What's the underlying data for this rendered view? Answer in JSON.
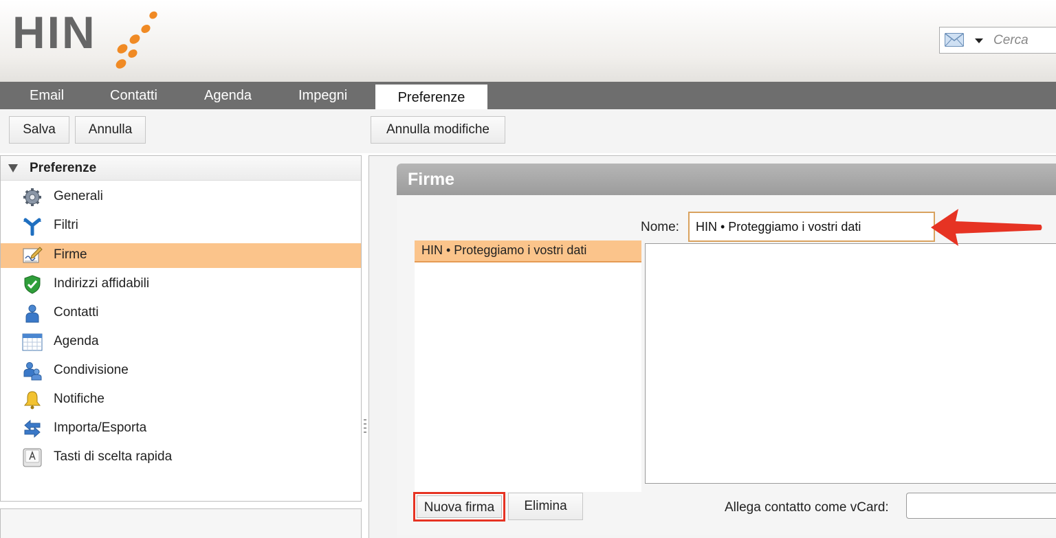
{
  "header": {
    "logo_text": "HIN",
    "search": {
      "placeholder": "Cerca",
      "icon": "envelope-icon"
    }
  },
  "nav": {
    "tabs": [
      {
        "label": "Email"
      },
      {
        "label": "Contatti"
      },
      {
        "label": "Agenda"
      },
      {
        "label": "Impegni"
      },
      {
        "label": "Preferenze",
        "active": true
      }
    ]
  },
  "toolbar": {
    "save_label": "Salva",
    "cancel_label": "Annulla",
    "undo_changes_label": "Annulla modifiche"
  },
  "sidebar": {
    "title": "Preferenze",
    "items": [
      {
        "label": "Generali",
        "icon": "gear-icon"
      },
      {
        "label": "Filtri",
        "icon": "filter-icon"
      },
      {
        "label": "Firme",
        "icon": "signature-icon",
        "selected": true
      },
      {
        "label": "Indirizzi affidabili",
        "icon": "shield-check-icon"
      },
      {
        "label": "Contatti",
        "icon": "person-icon"
      },
      {
        "label": "Agenda",
        "icon": "calendar-icon"
      },
      {
        "label": "Condivisione",
        "icon": "sharing-icon"
      },
      {
        "label": "Notifiche",
        "icon": "bell-icon"
      },
      {
        "label": "Importa/Esporta",
        "icon": "import-export-icon"
      },
      {
        "label": "Tasti di scelta rapida",
        "icon": "keyboard-key-icon"
      }
    ]
  },
  "firme": {
    "title": "Firme",
    "nome_label": "Nome:",
    "nome_value": "HIN • Proteggiamo i vostri dati",
    "signatures": [
      {
        "label": "HIN • Proteggiamo i vostri dati",
        "selected": true
      }
    ],
    "new_signature_label": "Nuova firma",
    "delete_label": "Elimina",
    "vcard_label": "Allega contatto come vCard:",
    "vcard_value": ""
  },
  "colors": {
    "selection": "#fbc48b",
    "nav_bar": "#6e6e6e",
    "highlight_red": "#e63323",
    "logo_orange": "#f08a24"
  }
}
